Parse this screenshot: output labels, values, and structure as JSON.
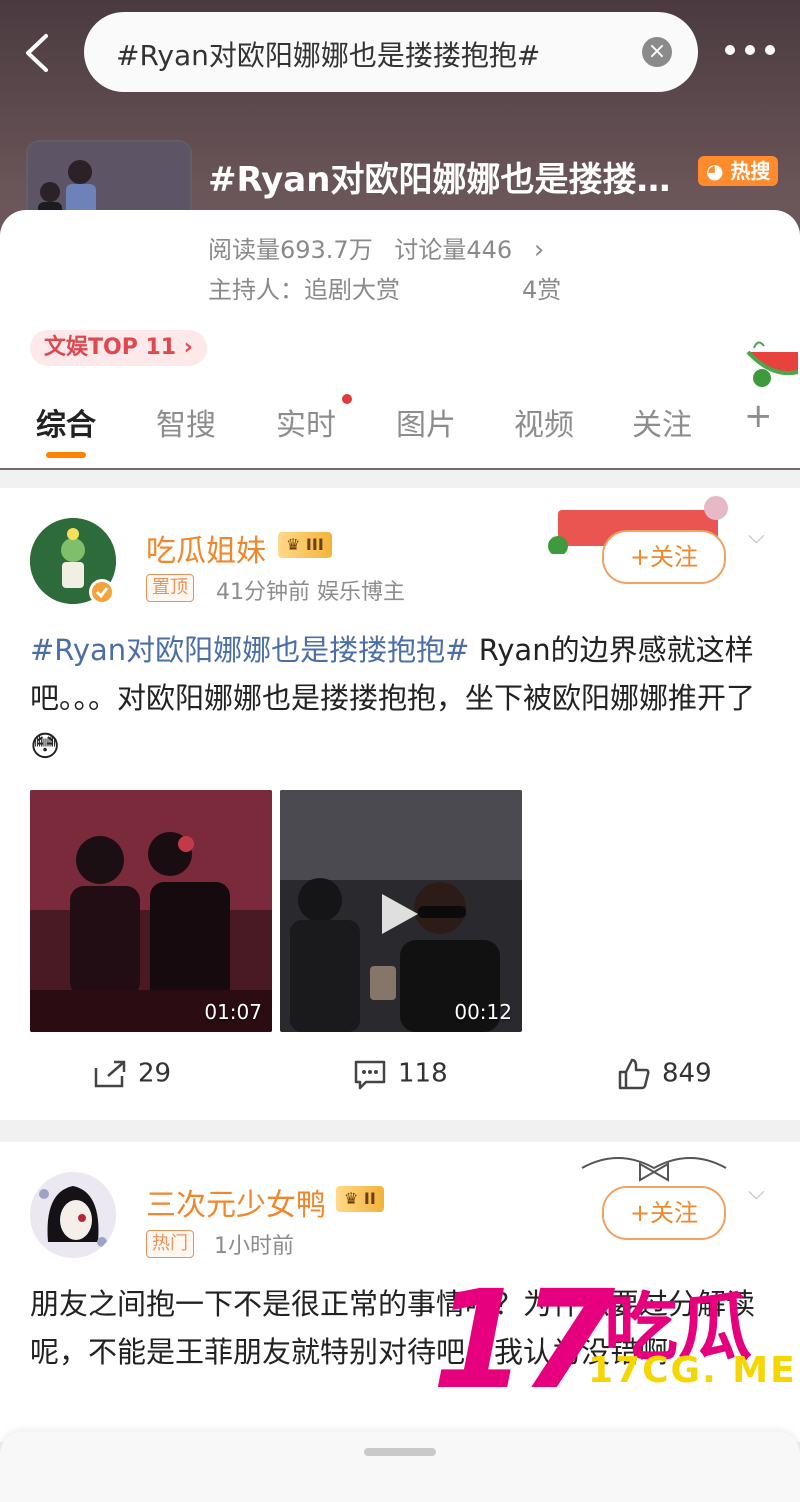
{
  "search": {
    "query": "#Ryan对欧阳娜娜也是搂搂抱抱#"
  },
  "topic": {
    "title": "#Ryan对欧阳娜娜也是搂搂…",
    "hot_badge": "热搜",
    "reads_label": "阅读量693.7万",
    "discussions_label": "讨论量446",
    "host": "主持人：追剧大赏",
    "reward": "4赏",
    "rank": "文娱TOP 11 ›"
  },
  "tabs": [
    {
      "label": "综合"
    },
    {
      "label": "智搜"
    },
    {
      "label": "实时"
    },
    {
      "label": "图片"
    },
    {
      "label": "视频"
    },
    {
      "label": "关注"
    },
    {
      "label": "+"
    }
  ],
  "posts": [
    {
      "author": "吃瓜姐妹",
      "vip": "III",
      "tag": "置顶",
      "meta": "41分钟前  娱乐博主",
      "follow": "+关注",
      "hashtag": "#Ryan对欧阳娜娜也是搂搂抱抱#",
      "text": " Ryan的边界感就这样吧。。。对欧阳娜娜也是搂搂抱抱，坐下被欧阳娜娜推开了",
      "emoji": "😳",
      "videos": [
        {
          "duration": "01:07"
        },
        {
          "duration": "00:12"
        }
      ],
      "reposts": "29",
      "comments": "118",
      "likes": "849"
    },
    {
      "author": "三次元少女鸭",
      "vip": "II",
      "tag": "热门",
      "meta": "1小时前",
      "follow": "+关注",
      "text": "朋友之间抱一下不是很正常的事情吗？为什么要过分解读呢，不能是王菲朋友就特别对待吧！我认为没错啊"
    }
  ],
  "watermark": {
    "number": "17",
    "brand": "吃瓜",
    "url": "17CG. ME"
  },
  "colors": {
    "accent": "#ff8200",
    "hashtag": "#4b6ea8",
    "name": "#f2862a",
    "watermark": "#e6007e"
  }
}
